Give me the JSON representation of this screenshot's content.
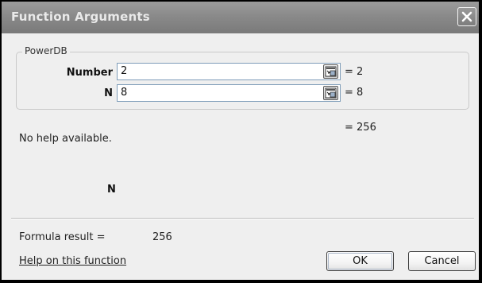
{
  "window": {
    "title": "Function Arguments",
    "close_icon": "close-icon"
  },
  "function": {
    "name": "PowerDB",
    "arguments": [
      {
        "label": "Number",
        "value": "2",
        "evaluated": "= 2",
        "collapse_icon": "collapse-dialog-icon"
      },
      {
        "label": "N",
        "value": "8",
        "evaluated": "= 8",
        "collapse_icon": "collapse-dialog-icon"
      }
    ],
    "overall_result": "= 256",
    "description": "No help available.",
    "current_argument_label": "N"
  },
  "footer": {
    "formula_result_label": "Formula result =",
    "formula_result_value": "256",
    "help_link": "Help on this function",
    "ok_label": "OK",
    "cancel_label": "Cancel"
  }
}
